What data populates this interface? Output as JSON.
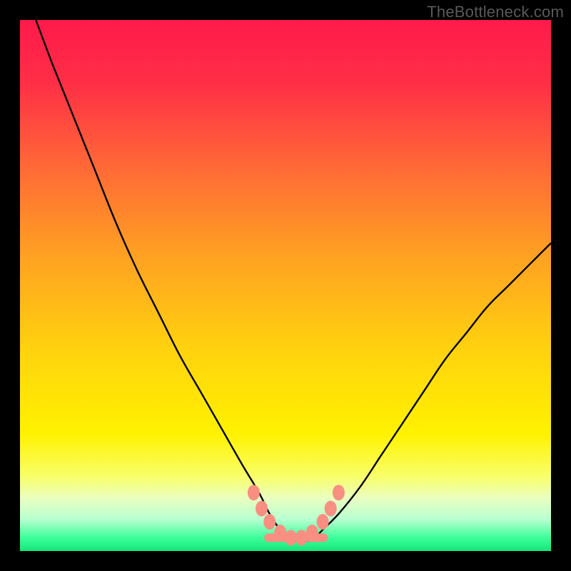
{
  "watermark": "TheBottleneck.com",
  "chart_data": {
    "type": "line",
    "title": "",
    "xlabel": "",
    "ylabel": "",
    "xlim": [
      0,
      100
    ],
    "ylim": [
      0,
      100
    ],
    "grid": false,
    "legend": false,
    "gradient_stops": [
      {
        "pos": 0.0,
        "color": "#ff1a4b"
      },
      {
        "pos": 0.12,
        "color": "#ff2f46"
      },
      {
        "pos": 0.28,
        "color": "#ff6a36"
      },
      {
        "pos": 0.45,
        "color": "#ffa321"
      },
      {
        "pos": 0.62,
        "color": "#ffd20e"
      },
      {
        "pos": 0.78,
        "color": "#fff200"
      },
      {
        "pos": 0.86,
        "color": "#f8ff6a"
      },
      {
        "pos": 0.9,
        "color": "#eaffc0"
      },
      {
        "pos": 0.94,
        "color": "#b9ffd0"
      },
      {
        "pos": 0.975,
        "color": "#3dff9a"
      },
      {
        "pos": 1.0,
        "color": "#14e57a"
      }
    ],
    "series": [
      {
        "name": "bottleneck-curve",
        "color": "#000000",
        "x": [
          3,
          6,
          10,
          14,
          18,
          22,
          26,
          30,
          34,
          38,
          42,
          45,
          47,
          49,
          51,
          53,
          55,
          57,
          60,
          64,
          68,
          72,
          76,
          80,
          84,
          88,
          92,
          96,
          100
        ],
        "y": [
          100,
          92,
          82,
          72,
          62,
          53,
          45,
          37,
          30,
          23,
          16,
          11,
          7,
          4,
          2,
          2,
          2,
          4,
          7,
          12,
          18,
          24,
          30,
          36,
          41,
          46,
          50,
          54,
          58
        ]
      }
    ],
    "trough_markers": {
      "color": "#f98f82",
      "points": [
        {
          "x": 44,
          "y": 11
        },
        {
          "x": 45.5,
          "y": 8
        },
        {
          "x": 47,
          "y": 5.5
        },
        {
          "x": 49,
          "y": 3.5
        },
        {
          "x": 51,
          "y": 2.5
        },
        {
          "x": 53,
          "y": 2.5
        },
        {
          "x": 55,
          "y": 3.5
        },
        {
          "x": 57,
          "y": 5.5
        },
        {
          "x": 58.5,
          "y": 8
        },
        {
          "x": 60,
          "y": 11
        }
      ]
    }
  }
}
